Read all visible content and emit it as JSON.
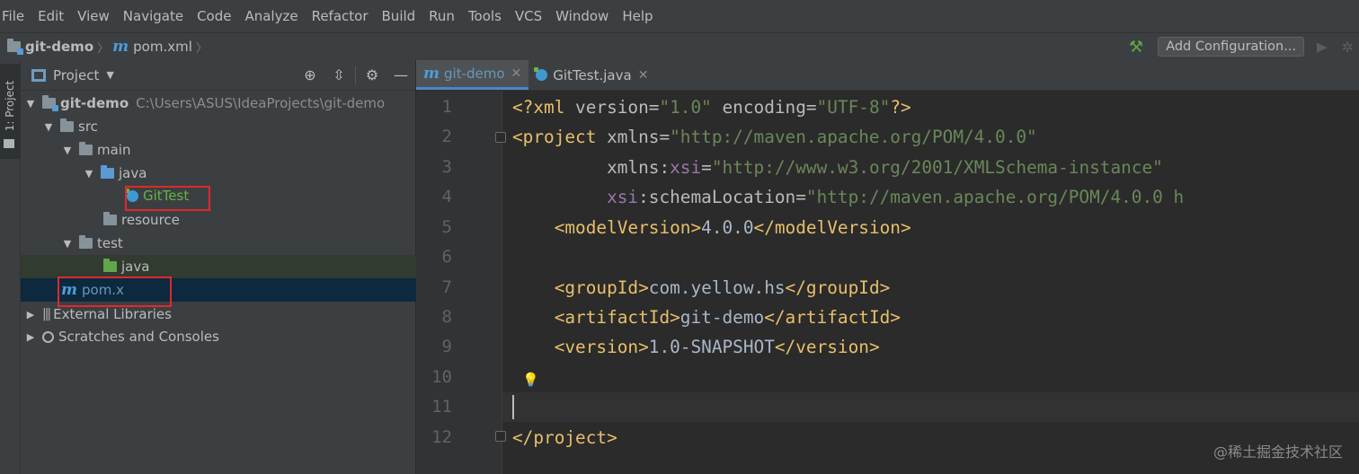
{
  "menu": [
    "File",
    "Edit",
    "View",
    "Navigate",
    "Code",
    "Analyze",
    "Refactor",
    "Build",
    "Run",
    "Tools",
    "VCS",
    "Window",
    "Help"
  ],
  "navbar": {
    "breadcrumb_project": "git-demo",
    "breadcrumb_file": "pom.xml",
    "add_configuration": "Add Configuration..."
  },
  "left_stripe": {
    "label": "1: Project"
  },
  "project_panel": {
    "title": "Project",
    "tree": {
      "root_name": "git-demo",
      "root_path": "C:\\Users\\ASUS\\IdeaProjects\\git-demo",
      "src": "src",
      "main": "main",
      "java": "java",
      "git_test": "GitTest",
      "resource": "resource",
      "test": "test",
      "test_java": "java",
      "pom": "pom.x",
      "external_libraries": "External Libraries",
      "scratches": "Scratches and Consoles"
    }
  },
  "editor": {
    "tabs": [
      {
        "label": "git-demo",
        "active": true
      },
      {
        "label": "GitTest.java",
        "active": false
      }
    ],
    "line_numbers": [
      "1",
      "2",
      "3",
      "4",
      "5",
      "6",
      "7",
      "8",
      "9",
      "10",
      "11",
      "12"
    ],
    "code": {
      "l1": [
        "<?xml ",
        "version=",
        "\"1.0\"",
        " encoding=",
        "\"UTF-8\"",
        "?>"
      ],
      "l2": [
        "<project ",
        "xmlns=",
        "\"http://maven.apache.org/POM/4.0.0\""
      ],
      "l3": [
        "xmlns:",
        "xsi",
        "=",
        "\"http://www.w3.org/2001/XMLSchema-instance\""
      ],
      "l4": [
        "xsi",
        ":schemaLocation=",
        "\"http://maven.apache.org/POM/4.0.0 h"
      ],
      "l5": [
        "<modelVersion>",
        "4.0.0",
        "</modelVersion>"
      ],
      "l7": [
        "<groupId>",
        "com.yellow.hs",
        "</groupId>"
      ],
      "l8": [
        "<artifactId>",
        "git-demo",
        "</artifactId>"
      ],
      "l9": [
        "<version>",
        "1.0-SNAPSHOT",
        "</version>"
      ],
      "l12": [
        "</project>"
      ]
    }
  },
  "watermark": "@稀土掘金技术社区",
  "colors": {
    "tag": "#e8bf6a",
    "attr_value": "#6a8759",
    "namespace": "#9876aa",
    "text": "#a9b7c6",
    "highlight_box": "#e0282e"
  }
}
